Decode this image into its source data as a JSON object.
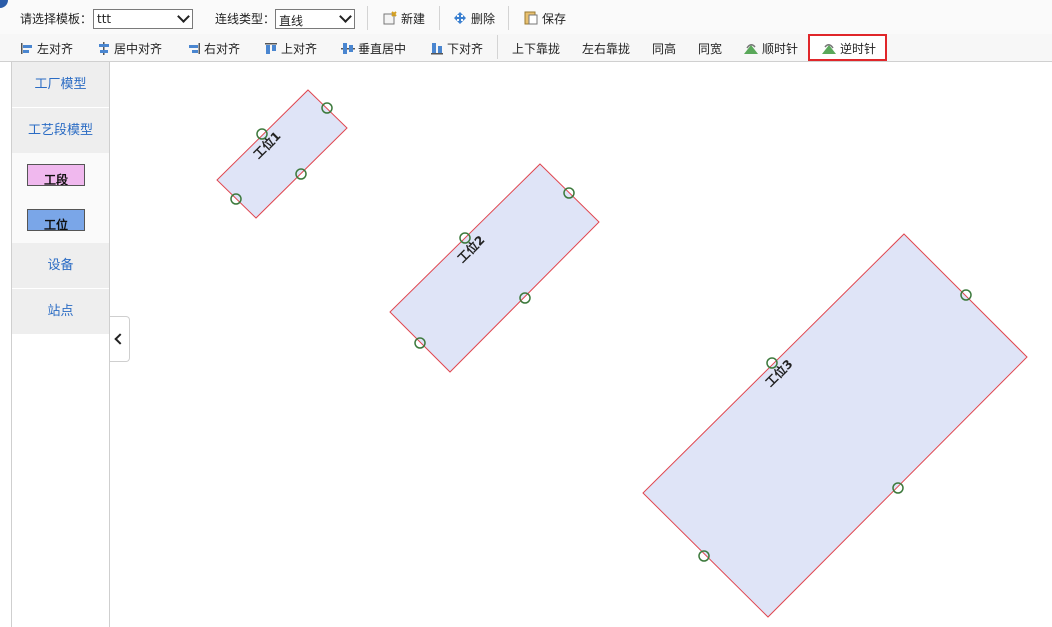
{
  "toolbar": {
    "template_label": "请选择模板：",
    "template_value": "ttt",
    "line_type_label": "连线类型：",
    "line_type_value": "直线",
    "new_label": "新建",
    "delete_label": "删除",
    "save_label": "保存"
  },
  "align_toolbar": {
    "left_align": "左对齐",
    "center_align": "居中对齐",
    "right_align": "右对齐",
    "top_align": "上对齐",
    "vertical_center": "垂直居中",
    "bottom_align": "下对齐",
    "stack_vertical": "上下靠拢",
    "stack_horizontal": "左右靠拢",
    "same_height": "同高",
    "same_width": "同宽",
    "clockwise": "顺时针",
    "counter_clockwise": "逆时针"
  },
  "sidebar": {
    "factory_model": "工厂模型",
    "process_model": "工艺段模型",
    "section_swatch": "工段",
    "station_swatch": "工位",
    "equipment": "设备",
    "site": "站点"
  },
  "colors": {
    "section_fill": "#f0b8ee",
    "station_fill": "#7aa6e8",
    "shape_fill": "#dfe4f7",
    "shape_stroke": "#e0464f",
    "port_stroke": "#3d7a3d",
    "highlight": "#e0262a"
  },
  "canvas_shapes": [
    {
      "label": "工位1"
    },
    {
      "label": "工位2"
    },
    {
      "label": "工位3"
    }
  ]
}
